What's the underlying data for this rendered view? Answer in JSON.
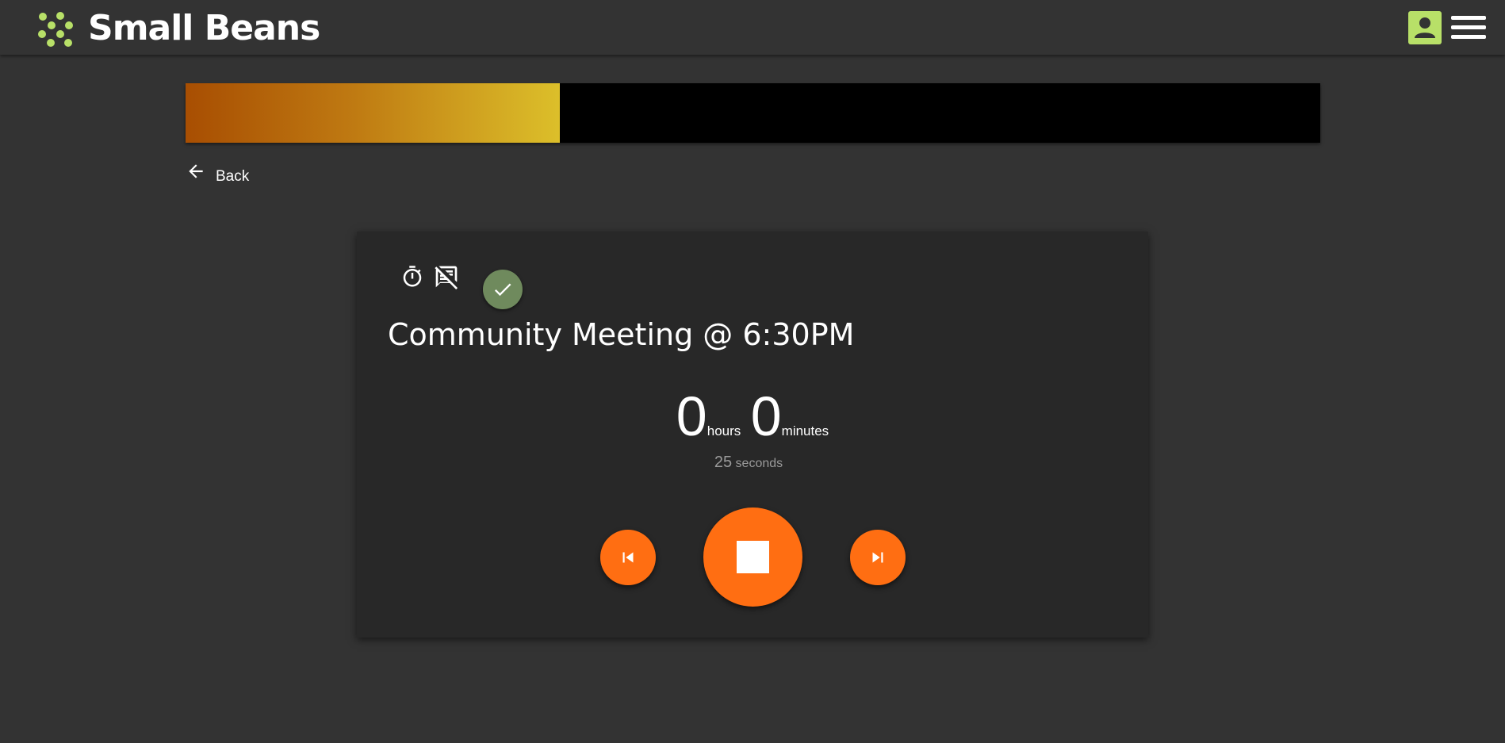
{
  "header": {
    "brand_name": "Small Beans",
    "logo_icon": "bean-dots-logo",
    "profile_icon": "contact-card-icon",
    "menu_icon": "hamburger-menu-icon",
    "accent_color": "#b8e068"
  },
  "progress": {
    "fraction_complete": 0.33,
    "fill_gradient": [
      "#a84e02",
      "#dcbf2a"
    ],
    "track_color": "#000000"
  },
  "nav": {
    "back_label": "Back",
    "back_icon": "arrow-left-icon"
  },
  "meeting": {
    "status_icons": [
      "timer-icon",
      "chat-off-icon",
      "check-icon"
    ],
    "title": "Community Meeting @ 6:30PM",
    "timer": {
      "hours": "0",
      "hours_label": "hours",
      "minutes": "0",
      "minutes_label": "minutes",
      "seconds": "25",
      "seconds_label": "seconds"
    },
    "controls": {
      "previous_icon": "skip-previous-icon",
      "stop_icon": "stop-icon",
      "next_icon": "skip-next-icon",
      "button_color": "#ff6e12"
    }
  }
}
